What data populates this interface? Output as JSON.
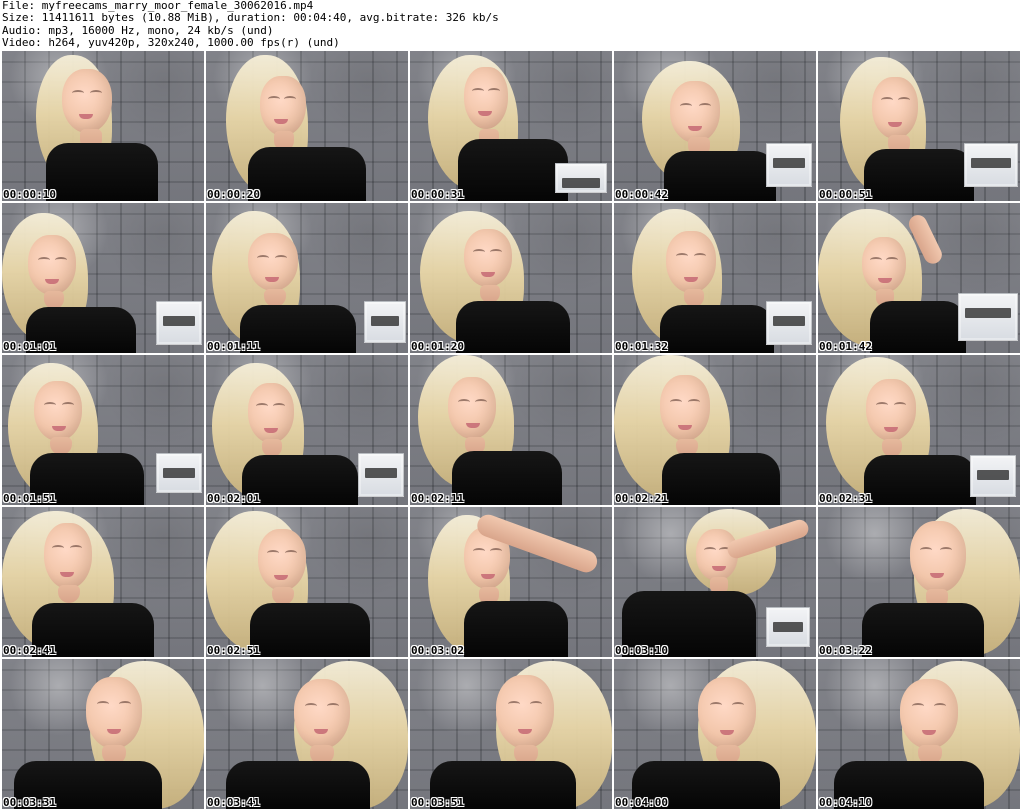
{
  "header": {
    "line1": "File: myfreecams_marry_moor_female_30062016.mp4",
    "line2": "Size: 11411611 bytes (10.88 MiB), duration: 00:04:40, avg.bitrate: 326 kb/s",
    "line3": "Audio: mp3, 16000 Hz, mono, 24 kb/s (und)",
    "line4": "Video: h264, yuv420p, 320x240, 1000.00 fps(r) (und)"
  },
  "thumbnails": [
    {
      "time": "00:00:10"
    },
    {
      "time": "00:00:20"
    },
    {
      "time": "00:00:31"
    },
    {
      "time": "00:00:42"
    },
    {
      "time": "00:00:51"
    },
    {
      "time": "00:01:01"
    },
    {
      "time": "00:01:11"
    },
    {
      "time": "00:01:20"
    },
    {
      "time": "00:01:32"
    },
    {
      "time": "00:01:42"
    },
    {
      "time": "00:01:51"
    },
    {
      "time": "00:02:01"
    },
    {
      "time": "00:02:11"
    },
    {
      "time": "00:02:21"
    },
    {
      "time": "00:02:31"
    },
    {
      "time": "00:02:41"
    },
    {
      "time": "00:02:51"
    },
    {
      "time": "00:03:02"
    },
    {
      "time": "00:03:10"
    },
    {
      "time": "00:03:22"
    },
    {
      "time": "00:03:31"
    },
    {
      "time": "00:03:41"
    },
    {
      "time": "00:03:51"
    },
    {
      "time": "00:04:00"
    },
    {
      "time": "00:04:10"
    }
  ]
}
